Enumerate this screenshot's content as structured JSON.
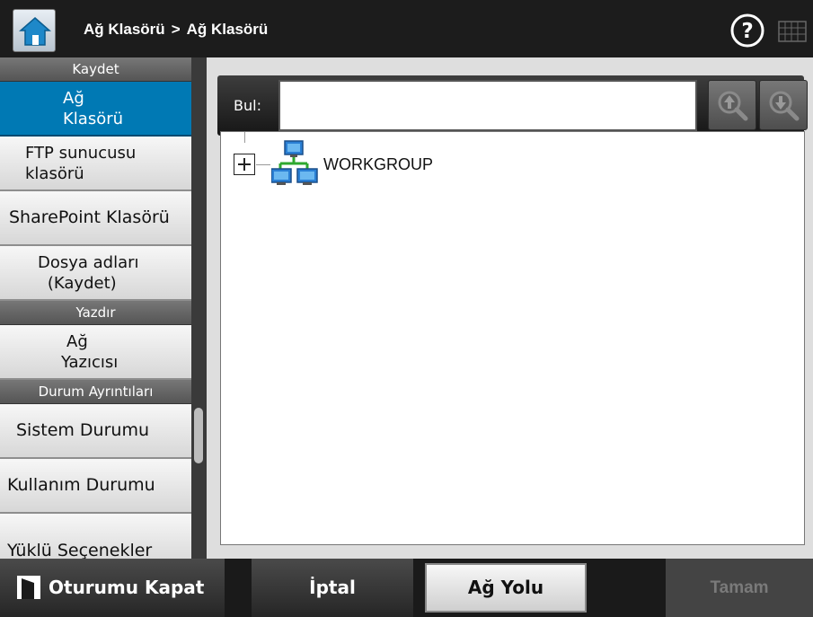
{
  "header": {
    "breadcrumb": [
      "Ağ Klasörü",
      "Ağ Klasörü"
    ],
    "separator": ">"
  },
  "sidebar": {
    "sections": [
      {
        "title": "Kaydet",
        "items": [
          {
            "line1": "Ağ",
            "line2": "Klasörü",
            "active": true
          },
          {
            "line1": "FTP sunucusu",
            "line2": "klasörü"
          },
          {
            "line1": "SharePoint Klasörü"
          },
          {
            "line1": "Dosya adları",
            "line2": "(Kaydet)"
          }
        ]
      },
      {
        "title": "Yazdır",
        "items": [
          {
            "line1": "Ağ",
            "line2": "Yazıcısı"
          }
        ]
      },
      {
        "title": "Durum Ayrıntıları",
        "items": [
          {
            "line1": "Sistem Durumu"
          },
          {
            "line1": "Kullanım Durumu"
          },
          {
            "line1": "Yüklü Seçenekler"
          }
        ]
      }
    ]
  },
  "find": {
    "label": "Bul:",
    "value": ""
  },
  "tree": {
    "nodes": [
      {
        "label": "WORKGROUP",
        "icon": "network-workgroup-icon",
        "expanded": false
      }
    ]
  },
  "footer": {
    "logout_label": "Oturumu Kapat",
    "cancel_label": "İptal",
    "network_path_label": "Ağ Yolu",
    "ok_label": "Tamam"
  },
  "colors": {
    "active": "#0079b4",
    "header_bg": "#1c1c1c",
    "disabled_text": "#7a7a7a"
  }
}
